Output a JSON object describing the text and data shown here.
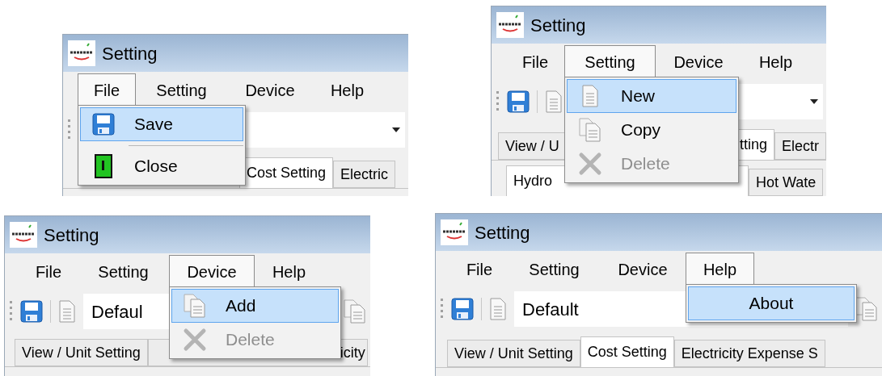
{
  "panels": [
    {
      "title": "Setting",
      "menus": [
        {
          "label": "File",
          "open": true
        },
        {
          "label": "Setting",
          "open": false
        },
        {
          "label": "Device",
          "open": false
        },
        {
          "label": "Help",
          "open": false
        }
      ],
      "dropdown": [
        {
          "kind": "item",
          "label": "Save",
          "highlighted": true,
          "disabled": false
        },
        {
          "kind": "separator"
        },
        {
          "kind": "item",
          "label": "Close",
          "highlighted": false,
          "disabled": false
        }
      ],
      "tabs": [
        {
          "label": "Cost Setting",
          "selected": true
        },
        {
          "label": "Electric",
          "selected": false
        }
      ]
    },
    {
      "title": "Setting",
      "menus": [
        {
          "label": "File",
          "open": false
        },
        {
          "label": "Setting",
          "open": true
        },
        {
          "label": "Device",
          "open": false
        },
        {
          "label": "Help",
          "open": false
        }
      ],
      "dropdown": [
        {
          "kind": "item",
          "label": "New",
          "highlighted": true,
          "disabled": false
        },
        {
          "kind": "item",
          "label": "Copy",
          "highlighted": false,
          "disabled": false
        },
        {
          "kind": "item",
          "label": "Delete",
          "highlighted": false,
          "disabled": true
        }
      ],
      "tabs": [
        {
          "label": "View / U",
          "selected": false
        },
        {
          "label": "tting",
          "selected": true
        },
        {
          "label": "Electr",
          "selected": false
        }
      ],
      "subtabs": [
        {
          "label": "Hydro",
          "selected": true
        },
        {
          "label": "Hot Wate",
          "selected": false
        }
      ]
    },
    {
      "title": "Setting",
      "menus": [
        {
          "label": "File",
          "open": false
        },
        {
          "label": "Setting",
          "open": false
        },
        {
          "label": "Device",
          "open": true
        },
        {
          "label": "Help",
          "open": false
        }
      ],
      "dropdown": [
        {
          "kind": "item",
          "label": "Add",
          "highlighted": true,
          "disabled": false
        },
        {
          "kind": "item",
          "label": "Delete",
          "highlighted": false,
          "disabled": true
        }
      ],
      "combo_value": "Defaul",
      "tabs": [
        {
          "label": "View / Unit Setting",
          "selected": false
        },
        {
          "label": "icity",
          "selected": false
        }
      ]
    },
    {
      "title": "Setting",
      "menus": [
        {
          "label": "File",
          "open": false
        },
        {
          "label": "Setting",
          "open": false
        },
        {
          "label": "Device",
          "open": false
        },
        {
          "label": "Help",
          "open": true
        }
      ],
      "dropdown": [
        {
          "kind": "item",
          "label": "About",
          "highlighted": true,
          "disabled": false
        }
      ],
      "combo_value": "Default",
      "tabs": [
        {
          "label": "View / Unit Setting",
          "selected": false
        },
        {
          "label": "Cost Setting",
          "selected": true
        },
        {
          "label": "Electricity Expense S",
          "selected": false
        }
      ]
    }
  ]
}
